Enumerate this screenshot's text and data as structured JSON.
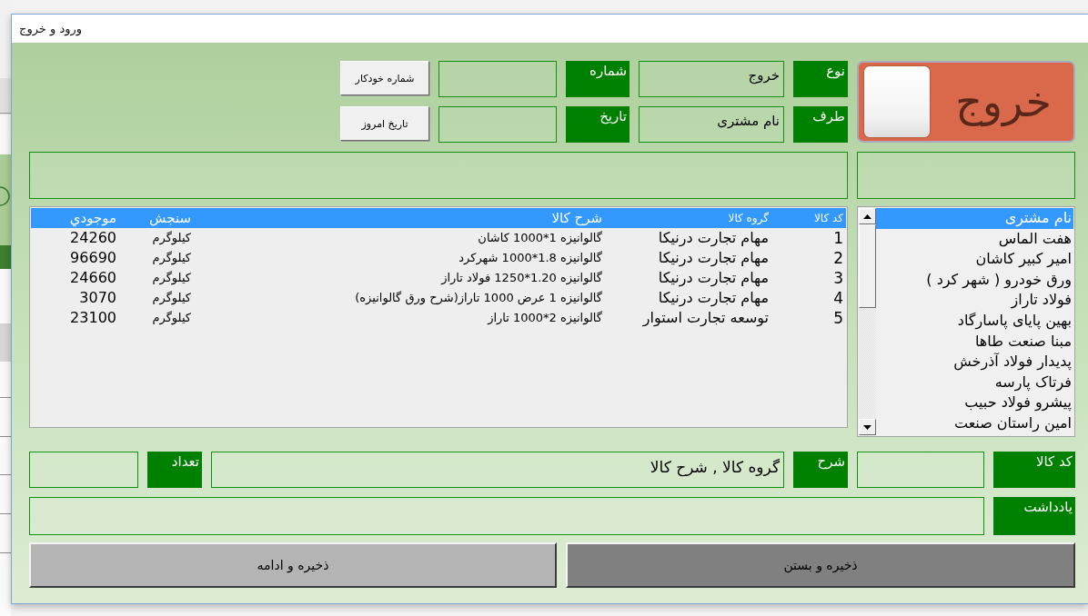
{
  "window": {
    "title": "ورود و خروج"
  },
  "mode_toggle": {
    "label": "خروج",
    "on": true
  },
  "header": {
    "type": {
      "label": "نوع",
      "value": "خروج"
    },
    "number": {
      "label": "شماره"
    },
    "auto_number_button": "شماره خودکار",
    "party": {
      "label": "طرف",
      "value": "نام مشتری"
    },
    "date": {
      "label": "تاریخ"
    },
    "today_button": "تاریخ امروز"
  },
  "items_table": {
    "columns": [
      "کد کالا",
      "گروه کالا",
      "شرح کالا",
      "سنجش",
      "موجودي"
    ],
    "rows": [
      [
        "1",
        "مهام تجارت درنیکا",
        "گالوانیزه 1*1000 کاشان",
        "کیلوگرم",
        "24260"
      ],
      [
        "2",
        "مهام تجارت درنیکا",
        "گالوانیزه 1.8*1000 شهرکرد",
        "کیلوگرم",
        "96690"
      ],
      [
        "3",
        "مهام تجارت درنیکا",
        "گالوانیزه 1.20*1250 فولاد تاراز",
        "کیلوگرم",
        "24660"
      ],
      [
        "4",
        "مهام تجارت درنیکا",
        "گالوانیزه 1 عرض 1000 تاراز(شرح ورق گالوانیزه)",
        "کیلوگرم",
        "3070"
      ],
      [
        "5",
        "توسعه تجارت استوار",
        "گالوانیزه 2*1000 تاراز",
        "کیلوگرم",
        "23100"
      ]
    ]
  },
  "customer_list": {
    "items": [
      {
        "text": "نام مشتری",
        "selected": true
      },
      {
        "text": "هفت الماس",
        "selected": false
      },
      {
        "text": "امیر کبیر کاشان",
        "selected": false
      },
      {
        "text": "ورق خودرو ( شهر کرد )",
        "selected": false
      },
      {
        "text": "فولاد تاراز",
        "selected": false
      },
      {
        "text": "بهین پایای پاسارگاد",
        "selected": false
      },
      {
        "text": "مبنا صنعت طاها",
        "selected": false
      },
      {
        "text": "پدیدار فولاد آذرخش",
        "selected": false
      },
      {
        "text": "فرتاک پارسه",
        "selected": false
      },
      {
        "text": "پیشرو فولاد حبیب",
        "selected": false
      },
      {
        "text": "امین راستان صنعت",
        "selected": false
      }
    ]
  },
  "item_entry": {
    "item_code": {
      "label": "کد کالا"
    },
    "description": {
      "label": "شرح",
      "value": "گروه کالا , شرح کالا"
    },
    "quantity": {
      "label": "تعداد"
    }
  },
  "note": {
    "label": "یادداشت"
  },
  "buttons": [
    {
      "label": "ذخیره و بستن",
      "kind": "dark"
    },
    {
      "label": "ذخیره و ادامه",
      "kind": "light"
    }
  ]
}
